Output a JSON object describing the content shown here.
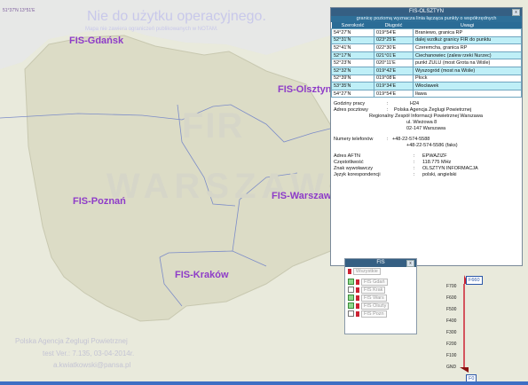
{
  "map": {
    "coord_label": "51°37'N 13°51'E",
    "watermark_title": "Nie do użytku operacyjnego.",
    "watermark_sub": "Mapa nie zawiera ograniczeń publikowanych w NOTAM.",
    "fir_label": "FIR",
    "warszawa_label": "WARSZAWA",
    "footer_org": "Polska Agencja Żeglugi Powietrznej",
    "footer_version": "test Ver.: 7.135, 03-04-2014r.",
    "footer_email": "a.kwiatkowski@pansa.pl",
    "fis_labels": {
      "gdansk": "FIS-Gdańsk",
      "olsztyn": "FIS-Olsztyn",
      "poznan": "FIS-Poznań",
      "warszawa": "FIS-Warszawa",
      "krakow": "FIS-Kraków"
    }
  },
  "info_window": {
    "title": "FIS-OLSZTYN",
    "close_glyph": "x",
    "subtitle": "granicę poziomą wyznacza linia łącząca punkty o współrzędnych",
    "columns": [
      "Szerokość",
      "Długość",
      "Uwagi"
    ],
    "rows": [
      {
        "lat": "54°27'N",
        "lon": "019°54'E",
        "note": "Braniewo, granica RP"
      },
      {
        "lat": "52°31'N",
        "lon": "023°25'E",
        "note": "dalej wzdłuż granicy FIR do punktu"
      },
      {
        "lat": "52°41'N",
        "lon": "022°30'E",
        "note": "Czeremcha, granica RP"
      },
      {
        "lat": "52°17'N",
        "lon": "021°01'E",
        "note": "Ciechanowiec (zalew rzeki Nurzec)"
      },
      {
        "lat": "52°23'N",
        "lon": "020°11'E",
        "note": "punkt ZULU (most Grota na Wiśle)"
      },
      {
        "lat": "52°32'N",
        "lon": "019°42'E",
        "note": "Wyszogród (most na Wiśle)"
      },
      {
        "lat": "52°39'N",
        "lon": "019°08'E",
        "note": "Płock"
      },
      {
        "lat": "53°35'N",
        "lon": "019°34'E",
        "note": "Włocławek"
      },
      {
        "lat": "54°27'N",
        "lon": "019°54'E",
        "note": "Iława"
      }
    ],
    "hours_label": "Godziny pracy",
    "hours_value": "H24",
    "address_label": "Adres pocztowy",
    "address_lines": [
      "Polska Agencja Żeglugi Powietrznej",
      "Regionalny Zespół Informacji Powietrznej Warszawa",
      "ul. Wieżowa 8",
      "02-147 Warszawa"
    ],
    "phone_label": "Numery telefonów",
    "phone_lines": [
      "+48-22-574-5588",
      "+48-22-574-5586 (faks)"
    ],
    "aftn_label": "Adres AFTN",
    "aftn_value": "EPWAZIZF",
    "freq_label": "Częstotliwość",
    "freq_value": "118.775 MHz",
    "callsign_label": "Znak wywoławczy",
    "callsign_value": "OLSZTYN INFORMACJA",
    "lang_label": "Język korespondencji",
    "lang_value": "polski, angielski"
  },
  "fis_panel": {
    "title": "FIS",
    "close_glyph": "x",
    "all_label": "Wszystkie",
    "layers": [
      {
        "label": "FIS Gdań",
        "checked": true
      },
      {
        "label": "FIS Krak",
        "checked": false
      },
      {
        "label": "FIS Wars",
        "checked": true
      },
      {
        "label": "FIS Olszty",
        "checked": true
      },
      {
        "label": "FIS Pozn",
        "checked": false
      }
    ]
  },
  "altitude": {
    "top_value": "F660",
    "bottom_value": "F0",
    "ticks": [
      "F700",
      "F600",
      "F500",
      "F400",
      "F300",
      "F200",
      "F100",
      "GND"
    ]
  },
  "colors": {
    "map_land": "#dcdcc6",
    "map_sea": "#e9eadc",
    "fis_label": "#8e3cc8",
    "window_title": "#355f83",
    "row_highlight": "#bfeff7"
  }
}
